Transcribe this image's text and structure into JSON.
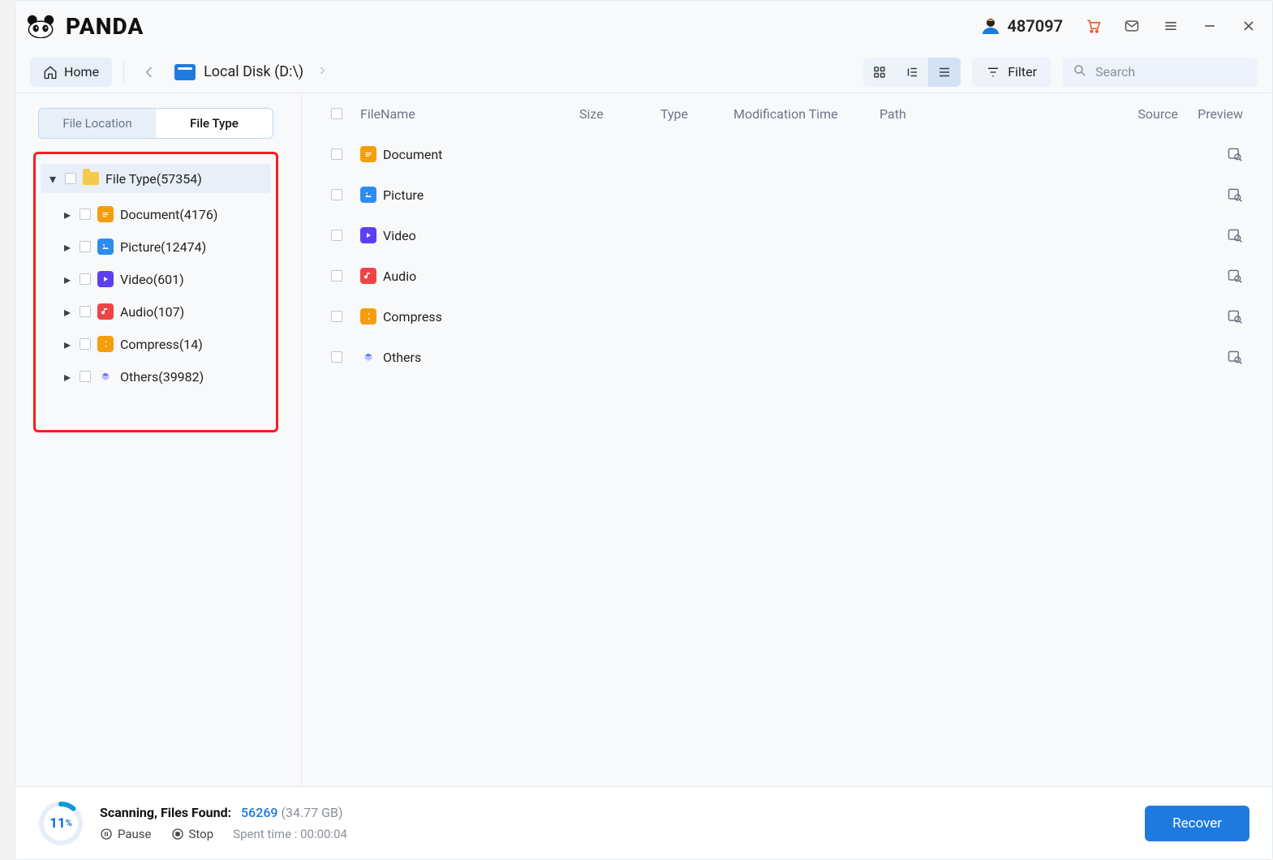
{
  "brand": {
    "name": "PANDA"
  },
  "titlebar": {
    "user_id": "487097"
  },
  "toolbar": {
    "home_label": "Home",
    "disk_label": "Local Disk (D:\\)",
    "filter_label": "Filter",
    "search_placeholder": "Search"
  },
  "sidebar": {
    "tabs": {
      "location": "File Location",
      "type": "File Type"
    },
    "root_label": "File Type(57354)",
    "items": [
      {
        "label": "Document(4176)",
        "icon": "doc"
      },
      {
        "label": "Picture(12474)",
        "icon": "pic"
      },
      {
        "label": "Video(601)",
        "icon": "vid"
      },
      {
        "label": "Audio(107)",
        "icon": "aud"
      },
      {
        "label": "Compress(14)",
        "icon": "zip"
      },
      {
        "label": "Others(39982)",
        "icon": "oth"
      }
    ]
  },
  "columns": {
    "name": "FileName",
    "size": "Size",
    "type": "Type",
    "mod": "Modification Time",
    "path": "Path",
    "src": "Source",
    "prev": "Preview"
  },
  "rows": [
    {
      "name": "Document",
      "icon": "doc"
    },
    {
      "name": "Picture",
      "icon": "pic"
    },
    {
      "name": "Video",
      "icon": "vid"
    },
    {
      "name": "Audio",
      "icon": "aud"
    },
    {
      "name": "Compress",
      "icon": "zip"
    },
    {
      "name": "Others",
      "icon": "oth"
    }
  ],
  "footer": {
    "progress_pct": "11",
    "progress_unit": "%",
    "status_label": "Scanning, Files Found:",
    "found_count": "56269",
    "found_size": "(34.77 GB)",
    "pause_label": "Pause",
    "stop_label": "Stop",
    "spent_label": "Spent time :",
    "spent_value": "00:00:04",
    "recover_label": "Recover"
  }
}
